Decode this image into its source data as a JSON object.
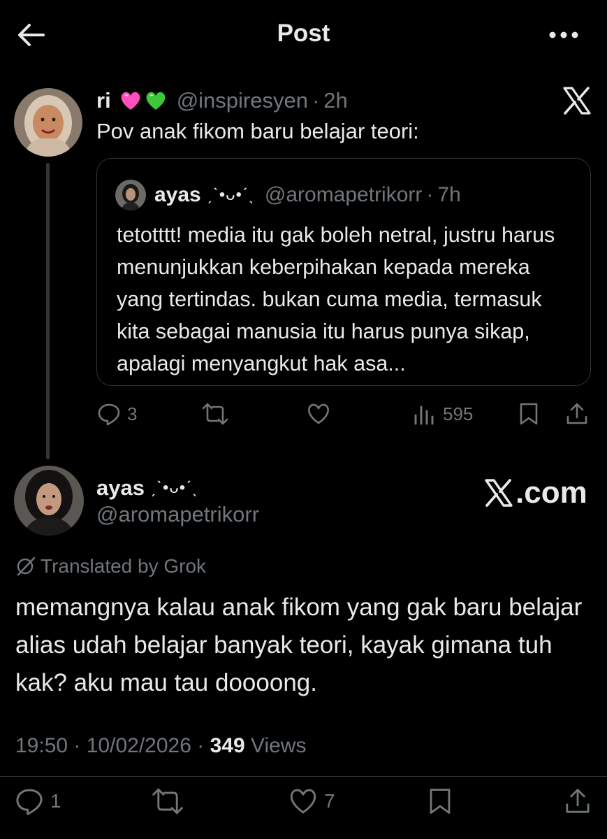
{
  "header": {
    "title": "Post",
    "back_icon": "arrow-left-icon",
    "more_icon": "more-horizontal-icon"
  },
  "parent": {
    "name": "ri",
    "emoji": [
      "pink-heart",
      "green-heart"
    ],
    "handle": "@inspiresyen",
    "time": "2h",
    "text": "Pov anak fikom baru belajar teori:",
    "watermark": "X",
    "quote": {
      "name": "ayas",
      "deco": "ˏˋ•ᴗ•ˊˎ",
      "handle": "@aromapetrikorr",
      "time": "7h",
      "text": "tetotttt! media itu gak boleh netral, justru harus menunjukkan keberpihakan kepada mereka yang tertindas. bukan cuma media, termasuk kita sebagai manusia itu harus punya sikap, apalagi menyangkut hak asa..."
    },
    "actions": {
      "replies": "3",
      "retweets": "",
      "likes": "",
      "views": "595"
    }
  },
  "reply": {
    "name": "ayas",
    "deco": "ˏˋ•ᴗ•ˊˎ",
    "handle": "@aromapetrikorr",
    "xcom": ".com",
    "translated": "Translated by Grok",
    "text": "memangnya kalau anak fikom yang gak baru belajar alias udah belajar banyak teori, kayak gimana tuh kak? aku mau tau doooong.",
    "time": "19:50",
    "date": "10/02/2026",
    "views_count": "349",
    "views_label": "Views",
    "actions": {
      "replies": "1",
      "retweets": "",
      "likes": "7"
    }
  },
  "colors": {
    "bg": "#000000",
    "text": "#e7e9ea",
    "muted": "#71767b",
    "border": "#2f3336"
  }
}
